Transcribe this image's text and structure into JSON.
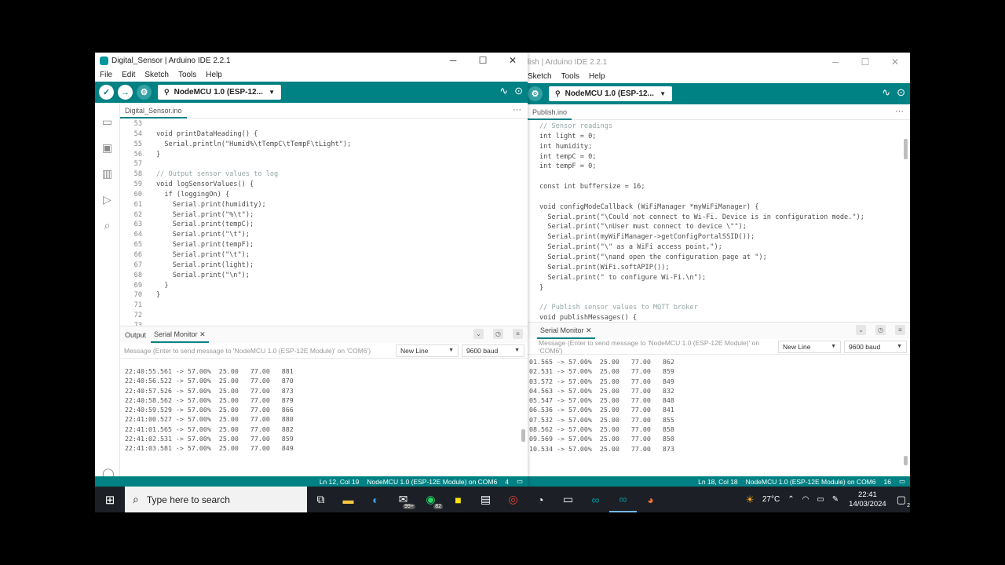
{
  "left_window": {
    "title": "Digital_Sensor | Arduino IDE 2.2.1",
    "menu": [
      "File",
      "Edit",
      "Sketch",
      "Tools",
      "Help"
    ],
    "board": "NodeMCU 1.0 (ESP-12...",
    "file_tab": "Digital_Sensor.ino",
    "code_lines": [
      {
        "n": "53",
        "t": ""
      },
      {
        "n": "54",
        "t": "void printDataHeading() {"
      },
      {
        "n": "55",
        "t": "  Serial.println(\"Humid%\\tTempC\\tTempF\\tLight\");"
      },
      {
        "n": "56",
        "t": "}"
      },
      {
        "n": "57",
        "t": ""
      },
      {
        "n": "58",
        "t": "// Output sensor values to log"
      },
      {
        "n": "59",
        "t": "void logSensorValues() {"
      },
      {
        "n": "60",
        "t": "  if (loggingOn) {"
      },
      {
        "n": "61",
        "t": "    Serial.print(humidity);"
      },
      {
        "n": "62",
        "t": "    Serial.print(\"%\\t\");"
      },
      {
        "n": "63",
        "t": "    Serial.print(tempC);"
      },
      {
        "n": "64",
        "t": "    Serial.print(\"\\t\");"
      },
      {
        "n": "65",
        "t": "    Serial.print(tempF);"
      },
      {
        "n": "66",
        "t": "    Serial.print(\"\\t\");"
      },
      {
        "n": "67",
        "t": "    Serial.print(light);"
      },
      {
        "n": "68",
        "t": "    Serial.print(\"\\n\");"
      },
      {
        "n": "69",
        "t": "  }"
      },
      {
        "n": "70",
        "t": "}"
      },
      {
        "n": "71",
        "t": ""
      },
      {
        "n": "72",
        "t": ""
      },
      {
        "n": "73",
        "t": ""
      }
    ],
    "panel_tabs": {
      "output": "Output",
      "serial_monitor": "Serial Monitor"
    },
    "message_placeholder": "Message (Enter to send message to 'NodeMCU 1.0 (ESP-12E Module)' on 'COM6')",
    "line_ending": "New Line",
    "baud": "9600 baud",
    "serial_lines": [
      "22:40:55.561 -> 57.00%  25.00   77.00   881",
      "22:40:56.522 -> 57.00%  25.00   77.00   870",
      "22:40:57.526 -> 57.00%  25.00   77.00   873",
      "22:40:58.562 -> 57.00%  25.00   77.00   879",
      "22:40:59.529 -> 57.00%  25.00   77.00   866",
      "22:41:00.527 -> 57.00%  25.00   77.00   880",
      "22:41:01.565 -> 57.00%  25.00   77.00   882",
      "22:41:02.531 -> 57.00%  25.00   77.00   859",
      "22:41:03.581 -> 57.00%  25.00   77.00   849"
    ],
    "status_pos": "Ln 12, Col 19",
    "status_board": "NodeMCU 1.0 (ESP-12E Module) on COM6",
    "status_count": "4"
  },
  "right_window": {
    "title": "Publish | Arduino IDE 2.2.1",
    "menu": [
      "Sketch",
      "Tools",
      "Help"
    ],
    "board": "NodeMCU 1.0 (ESP-12...",
    "file_tab": "Publish.ino",
    "code_lines": [
      "// Sensor readings",
      "int light = 0;",
      "int humidity;",
      "int tempC = 0;",
      "int tempF = 0;",
      "",
      "const int buffersize = 16;",
      "",
      "void configModeCallback (WiFiManager *myWiFiManager) {",
      "  Serial.print(\"\\Could not connect to Wi-Fi. Device is in configuration mode.\");",
      "  Serial.print(\"\\nUser must connect to device \\\"\");",
      "  Serial.print(myWiFiManager->getConfigPortalSSID());",
      "  Serial.print(\"\\\" as a WiFi access point,\");",
      "  Serial.print(\"\\nand open the configuration page at \");",
      "  Serial.print(WiFi.softAPIP());",
      "  Serial.print(\" to configure Wi-Fi.\\n\");",
      "}",
      "",
      "// Publish sensor values to MQTT broker",
      "void publishMessages() {"
    ],
    "panel_tab": "Serial Monitor",
    "message_placeholder": "Message (Enter to send message to 'NodeMCU 1.0 (ESP-12E Module)' on 'COM6')",
    "line_ending": "New Line",
    "baud": "9600 baud",
    "serial_lines": [
      "01.565 -> 57.00%  25.00   77.00   862",
      "02.531 -> 57.00%  25.00   77.00   859",
      "03.572 -> 57.00%  25.00   77.00   849",
      "04.563 -> 57.00%  25.00   77.00   832",
      "05.547 -> 57.00%  25.00   77.00   848",
      "06.536 -> 57.00%  25.00   77.00   841",
      "07.532 -> 57.00%  25.00   77.00   855",
      "08.562 -> 57.00%  25.00   77.00   858",
      "09.569 -> 57.00%  25.00   77.00   850",
      "10.534 -> 57.00%  25.00   77.00   873"
    ],
    "status_pos": "Ln 18, Col 18",
    "status_board": "NodeMCU 1.0 (ESP-12E Module) on COM6",
    "status_count": "16"
  },
  "taskbar": {
    "search_placeholder": "Type here to search",
    "mail_badge": "99+",
    "whatsapp_badge": "82",
    "weather": "27°C",
    "time": "22:41",
    "date": "14/03/2024",
    "notifications": "2"
  }
}
